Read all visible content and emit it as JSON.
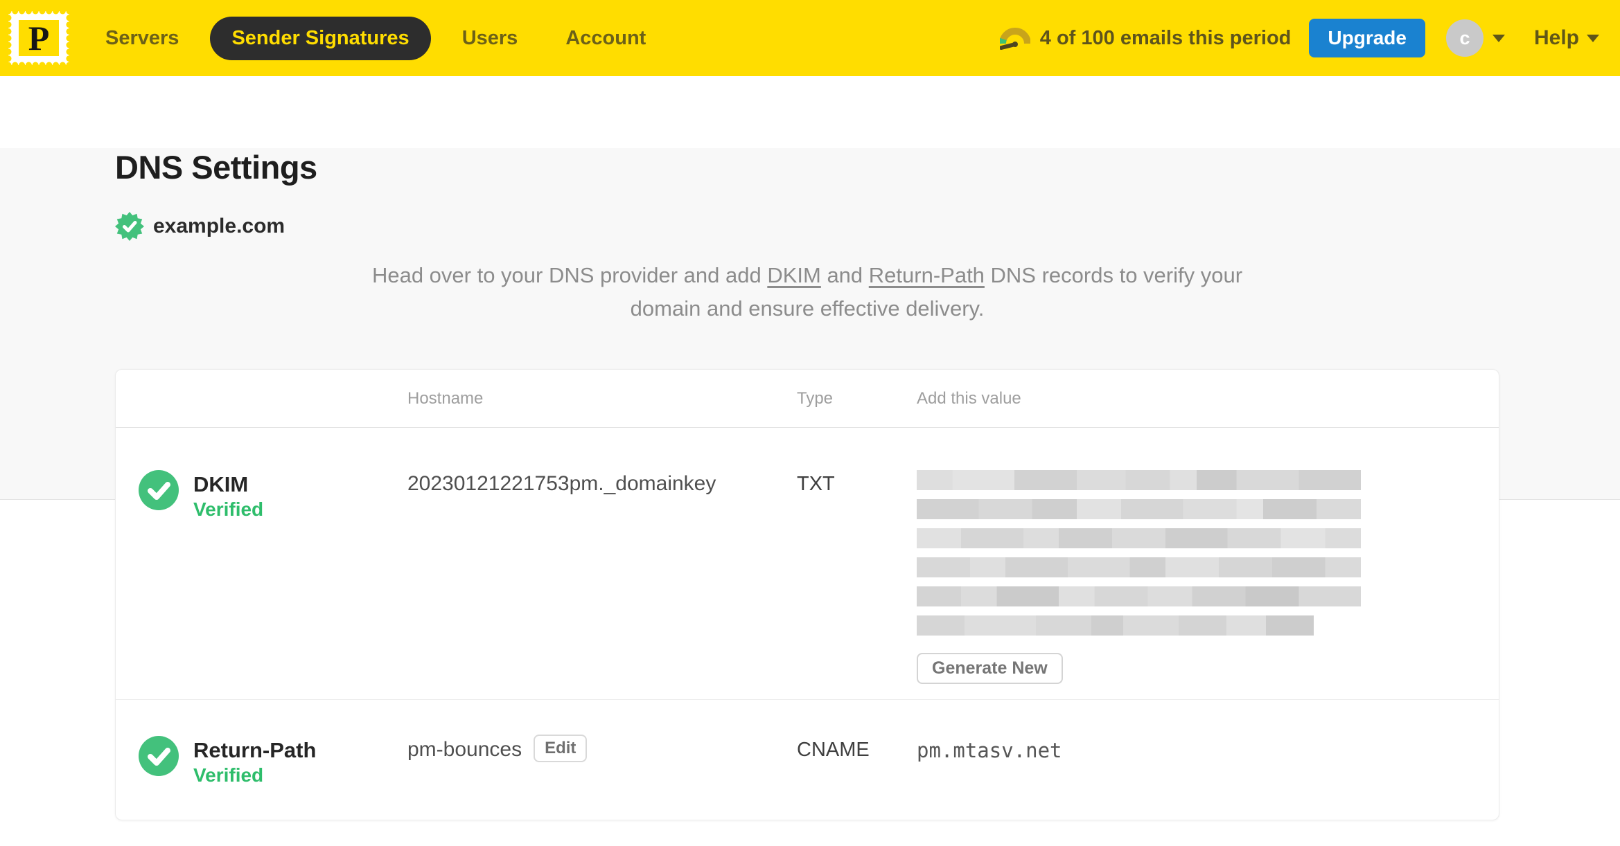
{
  "nav": {
    "logo_letter": "P",
    "items": [
      {
        "label": "Servers",
        "active": false
      },
      {
        "label": "Sender Signatures",
        "active": true
      },
      {
        "label": "Users",
        "active": false
      },
      {
        "label": "Account",
        "active": false
      }
    ],
    "usage_text": "4 of 100 emails this period",
    "upgrade_label": "Upgrade",
    "avatar_initial": "c",
    "help_label": "Help"
  },
  "page": {
    "title": "DNS Settings",
    "domain": "example.com",
    "intro": {
      "text_before": "Head over to your DNS provider and add ",
      "link_dkim": "DKIM",
      "text_between": " and ",
      "link_return_path": "Return-Path",
      "text_after": " DNS records to verify your domain and ensure effective delivery."
    }
  },
  "table": {
    "headers": {
      "hostname": "Hostname",
      "type": "Type",
      "value": "Add this value"
    },
    "rows": [
      {
        "name": "DKIM",
        "status": "Verified",
        "hostname": "20230121221753pm._domainkey",
        "type": "TXT",
        "value_redacted": true,
        "action_label": "Generate New"
      },
      {
        "name": "Return-Path",
        "status": "Verified",
        "hostname": "pm-bounces",
        "edit_label": "Edit",
        "type": "CNAME",
        "value": "pm.mtasv.net"
      }
    ]
  },
  "colors": {
    "nav_yellow": "#FFDD00",
    "nav_active_bg": "#2D2D2D",
    "upgrade_blue": "#1A82D0",
    "success_green": "#43C17C",
    "verified_text_green": "#2EBD6B"
  }
}
